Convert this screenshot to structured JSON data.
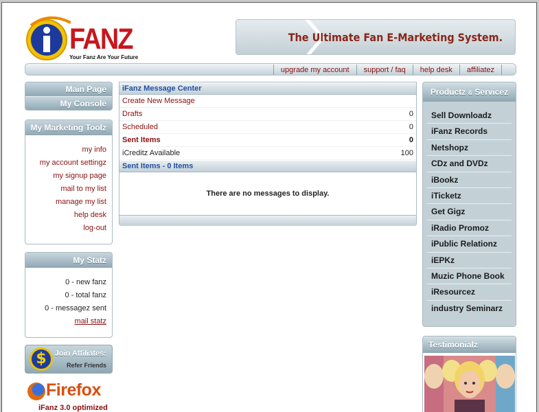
{
  "header": {
    "logo_text": "FANZ",
    "logo_tagline": "Your Fanz Are Your Future",
    "banner_text": "The Ultimate Fan E-Marketing System."
  },
  "topnav": {
    "links": [
      "upgrade my account",
      "support / faq",
      "help desk",
      "affiliatez"
    ]
  },
  "left": {
    "main_nav": [
      "Main Page",
      "My Console"
    ],
    "tools": {
      "title": "My Marketing Toolz",
      "items": [
        "my info",
        "my account settingz",
        "my signup page",
        "mail to my list",
        "manage my list",
        "help desk",
        "log-out"
      ]
    },
    "statz": {
      "title": "My Statz",
      "items": [
        "0 - new fanz",
        "0 - total fanz",
        "0 - messagez sent"
      ],
      "link": "mail statz"
    },
    "affiliates": {
      "title": "Join Affiliates:",
      "subtitle": "Refer Friends"
    },
    "firefox": {
      "name": "Firefox",
      "subtitle": "iFanz 3.0 optimized"
    }
  },
  "message_center": {
    "title": "iFanz Message Center",
    "create_link": "Create New Message",
    "rows": [
      {
        "label": "Drafts",
        "value": "0"
      },
      {
        "label": "Scheduled",
        "value": "0"
      },
      {
        "label": "Sent Items",
        "value": "0"
      },
      {
        "label": "iCreditz Available",
        "value": "100"
      }
    ],
    "section_title": "Sent Items - 0 Items",
    "empty_text": "There are no messages to display."
  },
  "right": {
    "productz_title": "Productz",
    "productz_amp": "&",
    "productz_title2": "Servicez",
    "productz": [
      "Sell Downloadz",
      "iFanz Records",
      "Netshopz",
      "CDz and DVDz",
      "iBookz",
      "iTicketz",
      "Get Gigz",
      "iRadio Promoz",
      "iPublic Relationz",
      "iEPKz",
      "Muzic Phone Book",
      "iResourcez",
      "industry Seminarz"
    ],
    "testimonialz_title": "Testimonialz"
  },
  "colors": {
    "accent_red": "#8b0e0e",
    "logo_red": "#c8161d",
    "header_blue": "#244f9e",
    "panel_blue": "#8fa8b5"
  }
}
